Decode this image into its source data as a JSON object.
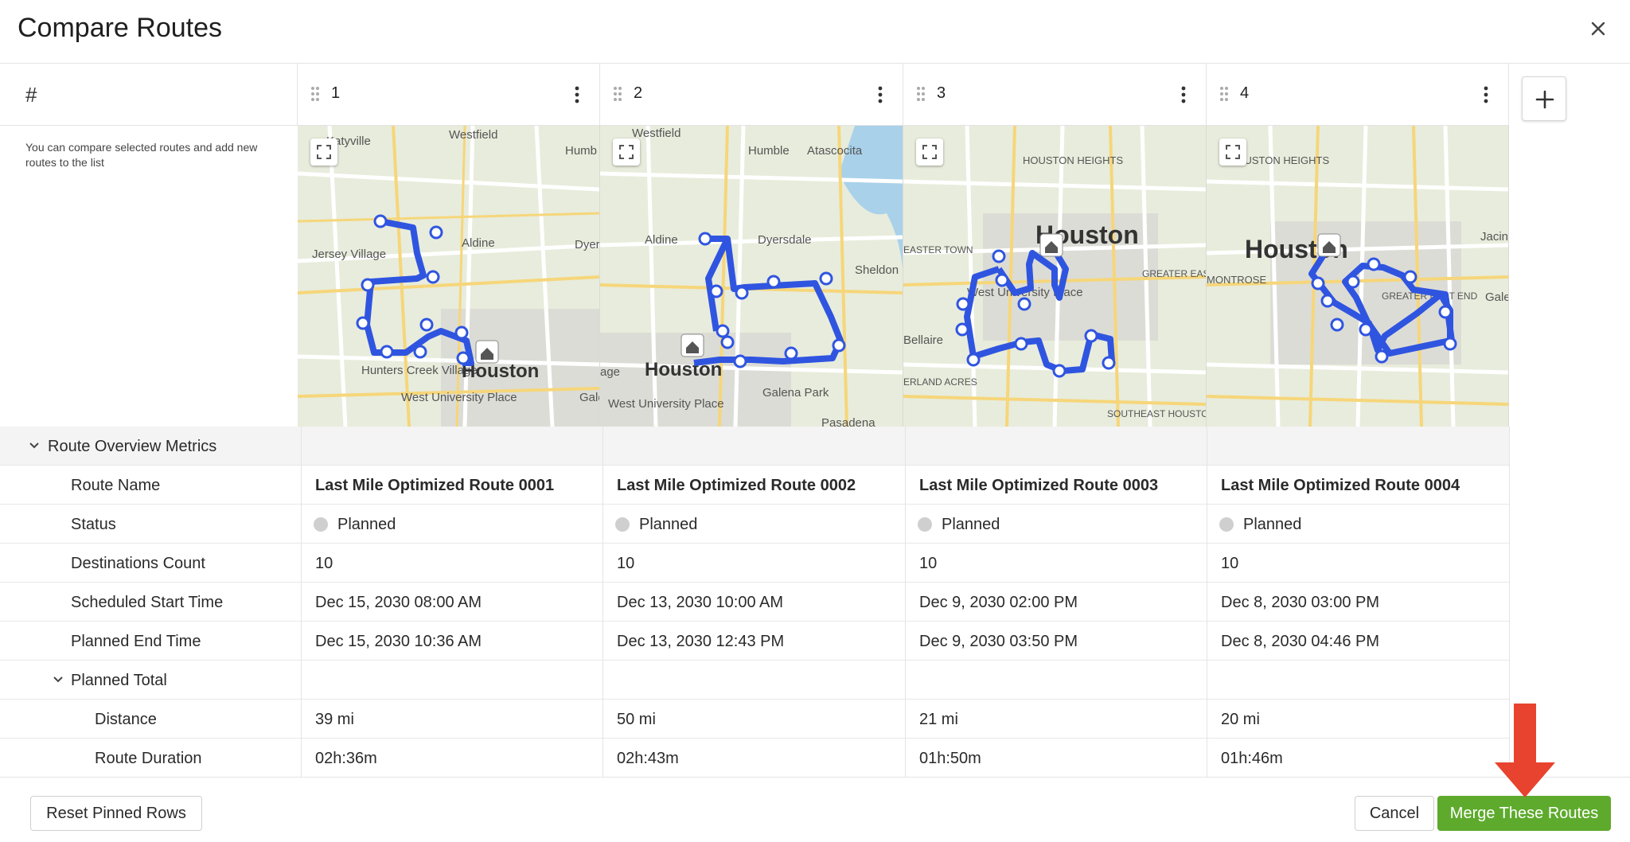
{
  "dialog": {
    "title": "Compare Routes",
    "close_icon": "close-icon"
  },
  "grid": {
    "index_header": "#",
    "hint": "You can compare selected routes and add new routes to the list",
    "columns": [
      {
        "number": "1",
        "map_labels": [
          "Katyville",
          "Westfield",
          "Humb",
          "Jersey Village",
          "Aldine",
          "Dyer",
          "Hunters Creek Village",
          "Houston",
          "West University Place",
          "Gale"
        ]
      },
      {
        "number": "2",
        "map_labels": [
          "Westfield",
          "Humble",
          "Atascocita",
          "Aldine",
          "Dyersdale",
          "Sheldon",
          "age",
          "Houston",
          "West University Place",
          "Galena Park",
          "Pasadena"
        ]
      },
      {
        "number": "3",
        "map_labels": [
          "HOUSTON HEIGHTS",
          "Houston",
          "West University Place",
          "Bellaire",
          "GREATER EAST",
          "EASTER TOWN",
          "SOUTHEAST HOUSTON",
          "ERLAND ACRES"
        ]
      },
      {
        "number": "4",
        "map_labels": [
          "HOUSTON HEIGHTS",
          "Houston",
          "Jacin",
          "MONTROSE",
          "GREATER EAST END",
          "Gale"
        ]
      }
    ],
    "add_column_icon": "plus-icon"
  },
  "sections": {
    "overview": "Route Overview Metrics",
    "planned_total": "Planned Total"
  },
  "rows": [
    {
      "key": "route_name",
      "label": "Route Name",
      "values": [
        "Last Mile Optimized Route 0001",
        "Last Mile Optimized Route 0002",
        "Last Mile Optimized Route 0003",
        "Last Mile Optimized Route 0004"
      ]
    },
    {
      "key": "status",
      "label": "Status",
      "values": [
        "Planned",
        "Planned",
        "Planned",
        "Planned"
      ]
    },
    {
      "key": "destinations",
      "label": "Destinations Count",
      "values": [
        "10",
        "10",
        "10",
        "10"
      ]
    },
    {
      "key": "start",
      "label": "Scheduled Start Time",
      "values": [
        "Dec 15, 2030 08:00 AM",
        "Dec 13, 2030 10:00 AM",
        "Dec 9, 2030 02:00 PM",
        "Dec 8, 2030 03:00 PM"
      ]
    },
    {
      "key": "end",
      "label": "Planned End Time",
      "values": [
        "Dec 15, 2030 10:36 AM",
        "Dec 13, 2030 12:43 PM",
        "Dec 9, 2030 03:50 PM",
        "Dec 8, 2030 04:46 PM"
      ]
    },
    {
      "key": "distance",
      "label": "Distance",
      "values": [
        "39 mi",
        "50 mi",
        "21 mi",
        "20 mi"
      ]
    },
    {
      "key": "duration",
      "label": "Route Duration",
      "values": [
        "02h:36m",
        "02h:43m",
        "01h:50m",
        "01h:46m"
      ]
    }
  ],
  "footer": {
    "reset": "Reset Pinned Rows",
    "cancel": "Cancel",
    "merge": "Merge These Routes"
  },
  "colors": {
    "route": "#2f55e0",
    "merge_button": "#5eaa2d",
    "arrow": "#e8432e",
    "status_dot": "#cfcfcf"
  }
}
